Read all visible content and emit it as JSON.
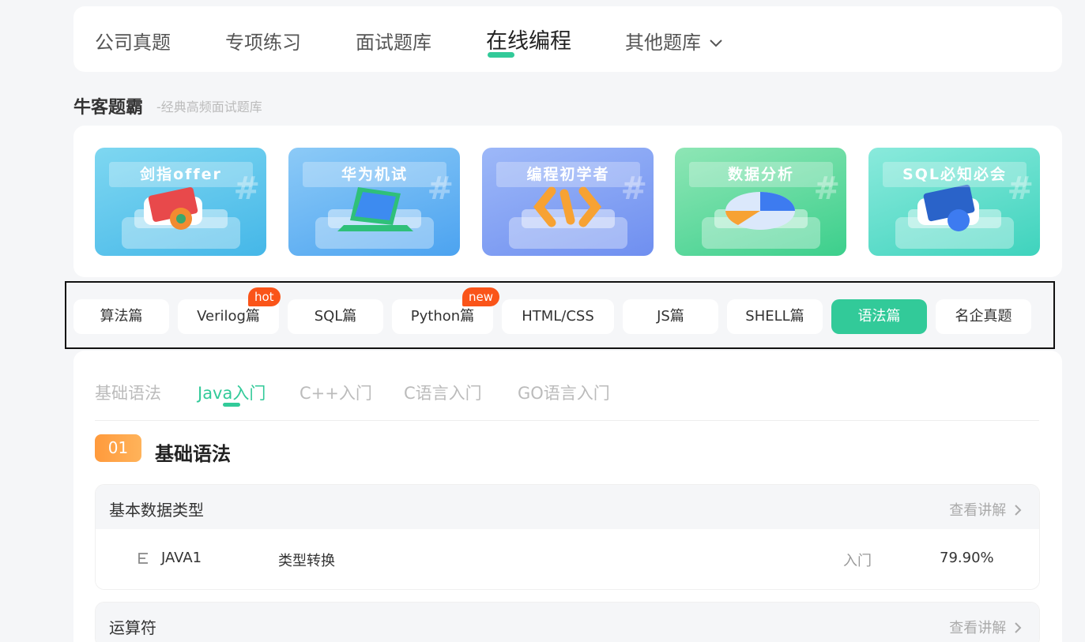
{
  "nav": {
    "tabs": [
      "公司真题",
      "专项练习",
      "面试题库",
      "在线编程",
      "其他题库"
    ],
    "active": "在线编程"
  },
  "section": {
    "title": "牛客题霸",
    "subtitle": "-经典高频面试题库"
  },
  "cards": [
    {
      "label": "剑指offer",
      "colors": [
        "#7ed7f1",
        "#45b7e8"
      ]
    },
    {
      "label": "华为机试",
      "colors": [
        "#8ccaf7",
        "#4ca3f0"
      ]
    },
    {
      "label": "编程初学者",
      "colors": [
        "#9db8f8",
        "#6f8ff0"
      ]
    },
    {
      "label": "数据分析",
      "colors": [
        "#8ee6b5",
        "#3ccf8c"
      ]
    },
    {
      "label": "SQL必知必会",
      "colors": [
        "#8aeadc",
        "#3fd3bd"
      ]
    }
  ],
  "categories": [
    {
      "label": "算法篇"
    },
    {
      "label": "Verilog篇",
      "badge": "hot"
    },
    {
      "label": "SQL篇"
    },
    {
      "label": "Python篇",
      "badge": "new"
    },
    {
      "label": "HTML/CSS"
    },
    {
      "label": "JS篇"
    },
    {
      "label": "SHELL篇"
    },
    {
      "label": "语法篇",
      "active": true
    },
    {
      "label": "名企真题"
    }
  ],
  "subtabs": [
    "基础语法",
    "Java入门",
    "C++入门",
    "C语言入门",
    "GO语言入门"
  ],
  "active_subtab": "Java入门",
  "group": {
    "number": "01",
    "title": "基础语法"
  },
  "blocks": [
    {
      "title": "基本数据类型",
      "link": "查看讲解",
      "rows": [
        {
          "id": "JAVA1",
          "name": "类型转换",
          "level": "入门",
          "rate": "79.90%"
        }
      ]
    },
    {
      "title": "运算符",
      "link": "查看讲解",
      "rows": []
    }
  ],
  "colors": {
    "accent": "#32ca99",
    "badge": "#fa5419",
    "number_badge": "#ff9a3c"
  }
}
